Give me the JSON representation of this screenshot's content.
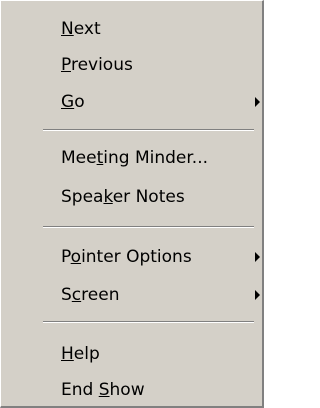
{
  "menu": {
    "items": [
      {
        "id": "next",
        "before": "",
        "mn": "N",
        "after": "ext",
        "submenu": false
      },
      {
        "id": "previous",
        "before": "",
        "mn": "P",
        "after": "revious",
        "submenu": false
      },
      {
        "id": "go",
        "before": "",
        "mn": "G",
        "after": "o",
        "submenu": true
      },
      {
        "id": "meeting-minder",
        "before": "Mee",
        "mn": "t",
        "after": "ing Minder...",
        "submenu": false
      },
      {
        "id": "speaker-notes",
        "before": "Spea",
        "mn": "k",
        "after": "er Notes",
        "submenu": false
      },
      {
        "id": "pointer-options",
        "before": "P",
        "mn": "o",
        "after": "inter Options",
        "submenu": true
      },
      {
        "id": "screen",
        "before": "S",
        "mn": "c",
        "after": "reen",
        "submenu": true
      },
      {
        "id": "help",
        "before": "",
        "mn": "H",
        "after": "elp",
        "submenu": false
      },
      {
        "id": "end-show",
        "before": "End ",
        "mn": "S",
        "after": "how",
        "submenu": false
      }
    ]
  },
  "colors": {
    "menu_background": "#d4d0c8",
    "text": "#000000",
    "separator_dark": "#808080",
    "separator_light": "#ffffff"
  },
  "icons": {
    "submenu_arrow": "chevron-right-icon"
  }
}
